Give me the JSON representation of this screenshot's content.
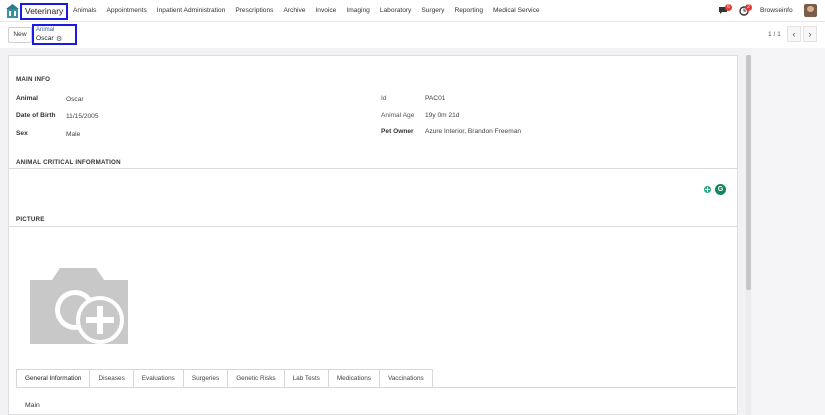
{
  "navbar": {
    "app_name": "Veterinary",
    "menu": [
      "Animals",
      "Appointments",
      "Inpatient Administration",
      "Prescriptions",
      "Archive",
      "Invoice",
      "Imaging",
      "Laboratory",
      "Surgery",
      "Reporting",
      "Medical Service"
    ],
    "chat_count": "6",
    "activity_count": "2",
    "company": "Browseinfo",
    "icons": [
      "app-home-icon",
      "chat-icon",
      "clock-icon",
      "avatar"
    ]
  },
  "control": {
    "new_label": "New",
    "breadcrumb_parent": "Animal",
    "breadcrumb_current": "Oscar",
    "pager": "1 / 1",
    "prev": "‹",
    "next": "›"
  },
  "form": {
    "main_info_title": "MAIN INFO",
    "fields_left": [
      {
        "label": "Animal",
        "value": "Oscar"
      },
      {
        "label": "Date of Birth",
        "value": "11/15/2005"
      },
      {
        "label": "Sex",
        "value": "Male"
      }
    ],
    "fields_right": [
      {
        "label": "Id",
        "value": "PAC01"
      },
      {
        "label": "Animal Age",
        "value": "19y 0m 21d"
      },
      {
        "label": "Pet Owner",
        "value": "Azure Interior, Brandon Freeman"
      }
    ],
    "critical_title": "ANIMAL CRITICAL INFORMATION",
    "picture_title": "PICTURE",
    "grammarly": "G"
  },
  "tabs": [
    "General Information",
    "Diseases",
    "Evaluations",
    "Surgeries",
    "Genetic Risks",
    "Lab Tests",
    "Medications",
    "Vaccinations"
  ],
  "tab_content": {
    "main_label": "Main"
  },
  "colors": {
    "highlight_box": "#1a1ae6",
    "badge": "#e53935",
    "grammarly": "#15855a"
  }
}
